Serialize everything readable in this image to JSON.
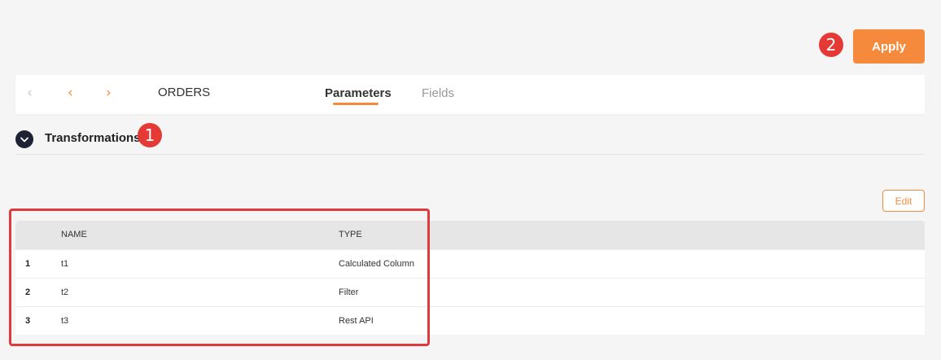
{
  "header": {
    "apply_label": "Apply",
    "apply_badge": "2"
  },
  "navbar": {
    "title": "ORDERS",
    "tabs": [
      {
        "label": "Parameters",
        "active": true
      },
      {
        "label": "Fields",
        "active": false
      }
    ]
  },
  "section": {
    "title": "Transformations",
    "badge": "1"
  },
  "toolbar": {
    "edit_label": "Edit"
  },
  "table": {
    "columns": [
      "NAME",
      "TYPE"
    ],
    "rows": [
      {
        "index": "1",
        "name": "t1",
        "type": "Calculated Column"
      },
      {
        "index": "2",
        "name": "t2",
        "type": "Filter"
      },
      {
        "index": "3",
        "name": "t3",
        "type": "Rest API"
      }
    ]
  },
  "colors": {
    "accent": "#f58a3c",
    "annotation": "#e53935",
    "toggle": "#1e2235"
  }
}
